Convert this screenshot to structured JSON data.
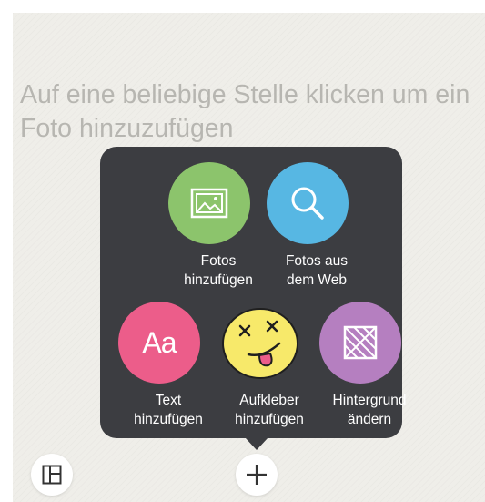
{
  "hint_text": "Auf eine beliebige Stelle klicken um ein Foto hinzuzufügen",
  "menu": {
    "items": [
      {
        "line1": "Fotos",
        "line2": "hinzufügen",
        "icon": "image-icon",
        "color": "#8cc46c"
      },
      {
        "line1": "Fotos aus",
        "line2": "dem Web",
        "icon": "search-icon",
        "color": "#57b7e3"
      },
      {
        "line1": "Text",
        "line2": "hinzufügen",
        "icon": "text-aa-icon",
        "icon_text": "Aa",
        "color": "#ec5d8a"
      },
      {
        "line1": "Aufkleber",
        "line2": "hinzufügen",
        "icon": "smiley-sticker-icon",
        "color": "#f7e96a"
      },
      {
        "line1": "Hintergrund",
        "line2": "ändern",
        "icon": "background-pattern-icon",
        "color": "#b57fc0"
      }
    ]
  },
  "bottom_bar": {
    "layout_icon": "layout-grid-icon",
    "add_icon": "plus-icon"
  },
  "colors": {
    "background": "#efeee9",
    "popup": "#3c3d41",
    "hint_text": "#b7b6b1"
  }
}
